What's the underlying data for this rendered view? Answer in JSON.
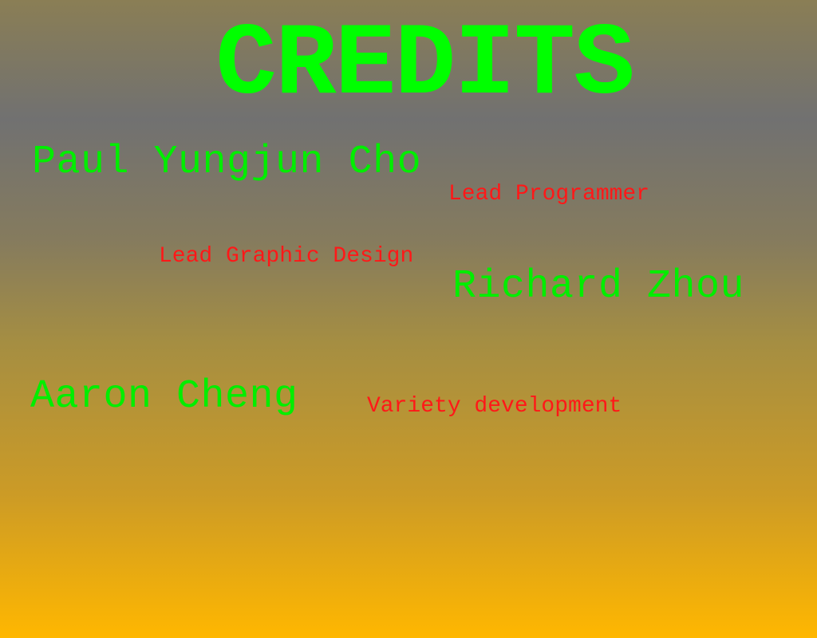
{
  "screen": {
    "title": "CREDITS",
    "credits": [
      {
        "name": "Paul Yungjun Cho",
        "role": "Lead Programmer"
      },
      {
        "name": "Richard Zhou",
        "role": "Lead Graphic Design"
      },
      {
        "name": "Aaron Cheng",
        "role": "Variety development"
      }
    ]
  },
  "colors": {
    "title": "#00ff00",
    "name": "#00ee00",
    "role": "#ff1818",
    "background_top": "#8a7e55",
    "background_mid": "#717171",
    "background_bottom": "#ffb700"
  }
}
